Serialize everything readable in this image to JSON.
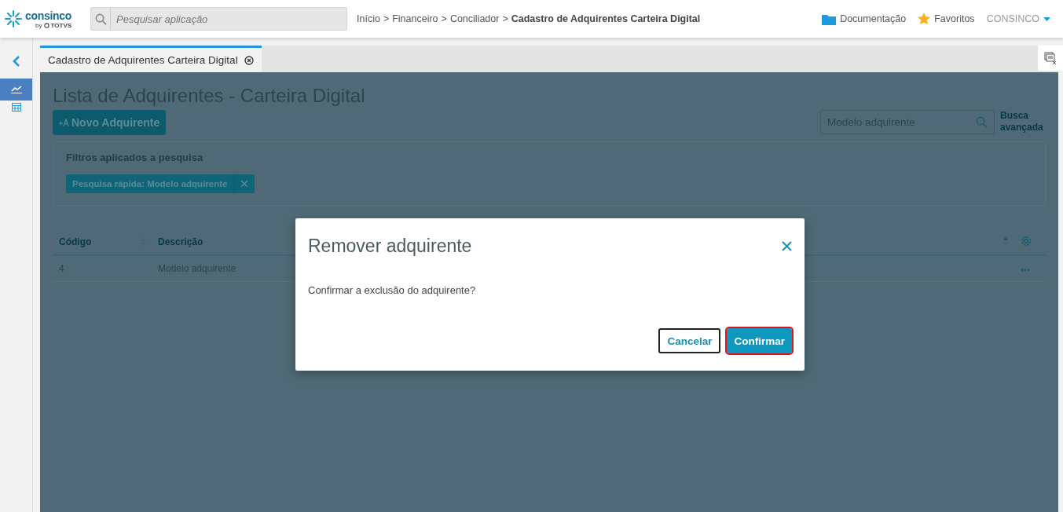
{
  "header": {
    "logo": {
      "name": "consinco",
      "by": "by",
      "brand": "TOTVS"
    },
    "search": {
      "placeholder": "Pesquisar aplicação"
    },
    "breadcrumb": {
      "separator": ">",
      "items": [
        "Início",
        "Financeiro",
        "Conciliador",
        "Cadastro de Adquirentes Carteira Digital"
      ]
    },
    "links": [
      {
        "kind": "folder",
        "label": "Documentação"
      },
      {
        "kind": "star",
        "label": "Favoritos"
      }
    ],
    "user": "CONSINCO"
  },
  "sidebar": {
    "items": [
      {
        "kind": "chart",
        "selected": true
      },
      {
        "kind": "grid",
        "selected": false
      }
    ]
  },
  "tabs": [
    {
      "label": "Cadastro de Adquirentes Carteira Digital",
      "selected": true
    }
  ],
  "page": {
    "title": "Lista de Adquirentes - Carteira Digital",
    "new_button": "Novo Adquirente",
    "search": {
      "value": "Modelo adquirente"
    },
    "advanced_search": "Busca avançada",
    "filters": {
      "title": "Filtros aplicados a pesquisa",
      "chips": [
        "Pesquisa rápida: Modelo adquirente"
      ]
    },
    "table": {
      "columns": [
        "Código",
        "Descrição"
      ],
      "rows": [
        {
          "cells": [
            "4",
            "Modelo adquirente"
          ]
        }
      ]
    }
  },
  "dialog": {
    "title": "Remover adquirente",
    "message": "Confirmar a exclusão do adquirente?",
    "buttons": [
      {
        "label": "Cancelar",
        "kind": "secondary",
        "focused": false
      },
      {
        "label": "Confirmar",
        "kind": "primary",
        "focused": true
      }
    ]
  }
}
